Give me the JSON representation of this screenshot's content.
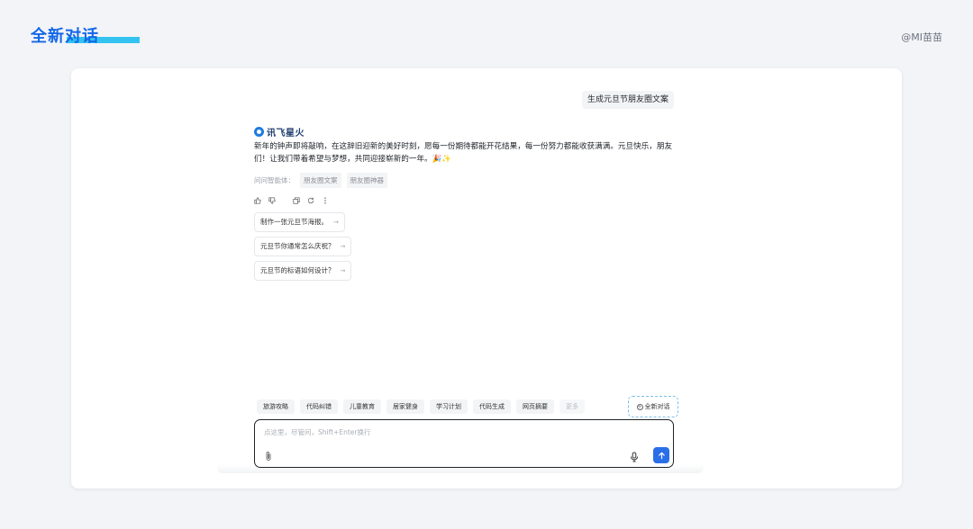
{
  "header": {
    "title": "全新对话",
    "author": "@MI苗苗",
    "accent_color": "#1367e8",
    "underline_color": "#34c3f0"
  },
  "conversation": {
    "user_message": "生成元旦节朋友圈文案",
    "assistant": {
      "brand_name": "讯飞星火",
      "brand_icon": "spark-logo-icon",
      "answer_text": "新年的钟声即将敲响，在这辞旧迎新的美好时刻，愿每一份期待都能开花结果，每一份努力都能收获满满。元旦快乐，朋友们！让我们带着希望与梦想，共同迎接崭新的一年。🎉✨",
      "source_label": "问问智能体：",
      "source_tags": [
        "朋友圈文案",
        "朋友圈神器"
      ],
      "actions": [
        "thumbs-up-icon",
        "thumbs-down-icon",
        "copy-icon",
        "regenerate-icon",
        "more-icon"
      ]
    },
    "suggestions": [
      "制作一张元旦节海报。",
      "元旦节你通常怎么庆祝？",
      "元旦节的标语如何设计？"
    ]
  },
  "composer": {
    "chips": [
      "旅游攻略",
      "代码纠错",
      "儿童教育",
      "居家健身",
      "学习计划",
      "代码生成",
      "网页摘要",
      "更多"
    ],
    "new_chat_label": "全新对话",
    "placeholder": "点这里，尽管问，Shift+Enter换行",
    "send_color": "#2a6ee8"
  }
}
